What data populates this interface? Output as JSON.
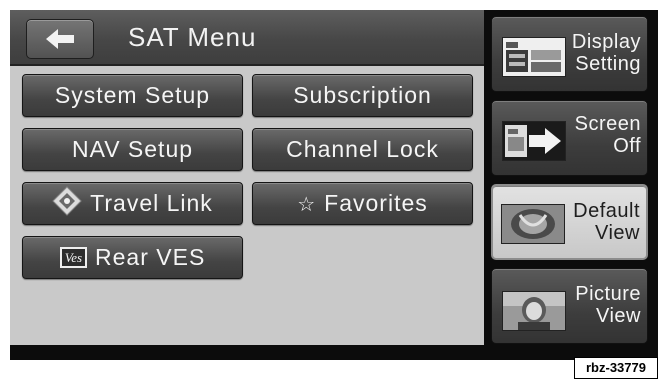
{
  "header": {
    "title": "SAT Menu",
    "back_icon": "left-arrow-icon"
  },
  "menu": {
    "system_setup": "System Setup",
    "subscription": "Subscription",
    "nav_setup": "NAV Setup",
    "channel_lock": "Channel Lock",
    "travel_link": "Travel Link",
    "favorites": "Favorites",
    "favorites_icon": "☆",
    "rear_ves": "Rear VES",
    "ves_icon_text": "Ves"
  },
  "side": {
    "display_setting": [
      "Display",
      "Setting"
    ],
    "screen_off": [
      "Screen",
      "Off"
    ],
    "default_view": [
      "Default",
      "View"
    ],
    "picture_view": [
      "Picture",
      "View"
    ],
    "active": "default_view"
  },
  "footer": {
    "credit": "rbz-33779"
  }
}
